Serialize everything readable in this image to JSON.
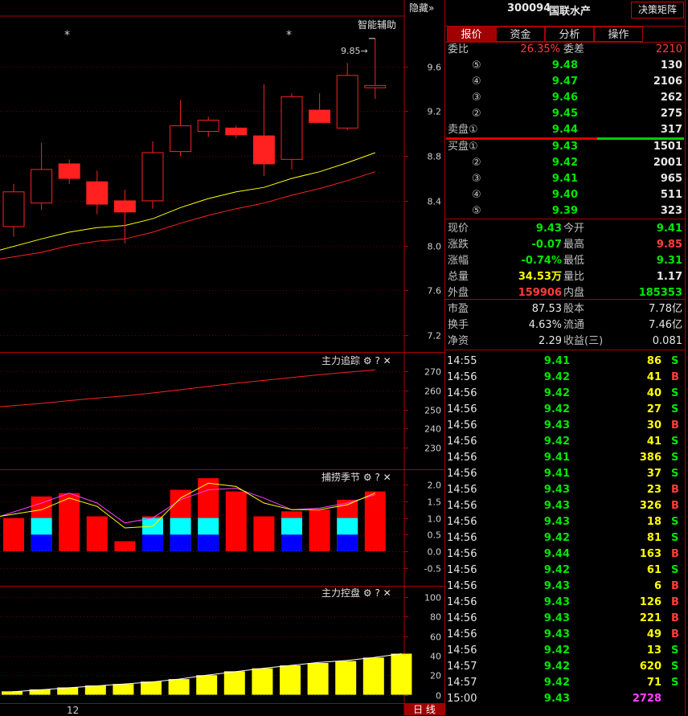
{
  "header": {
    "hide_label": "隐藏»",
    "stock_code": "300094",
    "stock_name": "国联水产",
    "matrix_button": "决策矩阵"
  },
  "tabs": [
    {
      "label": "报价",
      "active": true
    },
    {
      "label": "资金",
      "active": false
    },
    {
      "label": "分析",
      "active": false
    },
    {
      "label": "操作",
      "active": false
    }
  ],
  "order_book": {
    "weibi_label": "委比",
    "weibi_value": "26.35%",
    "weicha_label": "委差",
    "weicha_value": "2210",
    "sell": [
      {
        "label": "⑤",
        "price": "9.48",
        "vol": "130"
      },
      {
        "label": "④",
        "price": "9.47",
        "vol": "2106"
      },
      {
        "label": "③",
        "price": "9.46",
        "vol": "262"
      },
      {
        "label": "②",
        "price": "9.45",
        "vol": "275"
      },
      {
        "label": "卖盘①",
        "price": "9.44",
        "vol": "317"
      }
    ],
    "buy": [
      {
        "label": "买盘①",
        "price": "9.43",
        "vol": "1501"
      },
      {
        "label": "②",
        "price": "9.42",
        "vol": "2001"
      },
      {
        "label": "③",
        "price": "9.41",
        "vol": "965"
      },
      {
        "label": "④",
        "price": "9.40",
        "vol": "511"
      },
      {
        "label": "⑤",
        "price": "9.39",
        "vol": "323"
      }
    ]
  },
  "quote": [
    {
      "l1": "现价",
      "v1": "9.43",
      "c1": "green",
      "l2": "今开",
      "v2": "9.41",
      "c2": "green"
    },
    {
      "l1": "涨跌",
      "v1": "-0.07",
      "c1": "green",
      "l2": "最高",
      "v2": "9.85",
      "c2": "red"
    },
    {
      "l1": "涨幅",
      "v1": "-0.74%",
      "c1": "green",
      "l2": "最低",
      "v2": "9.31",
      "c2": "green"
    },
    {
      "l1": "总量",
      "v1": "34.53万",
      "c1": "yellow",
      "l2": "量比",
      "v2": "1.17",
      "c2": "white"
    },
    {
      "l1": "外盘",
      "v1": "159906",
      "c1": "red",
      "l2": "内盘",
      "v2": "185353",
      "c2": "green"
    }
  ],
  "finance": [
    {
      "l1": "市盈",
      "v1": "87.53",
      "l2": "股本",
      "v2": "7.78亿"
    },
    {
      "l1": "换手",
      "v1": "4.63%",
      "l2": "流通",
      "v2": "7.46亿"
    },
    {
      "l1": "净资",
      "v1": "2.29",
      "l2": "收益(三)",
      "v2": "0.081"
    }
  ],
  "ticks": [
    {
      "time": "14:55",
      "price": "9.41",
      "vol": "86",
      "side": "S"
    },
    {
      "time": "14:56",
      "price": "9.42",
      "vol": "41",
      "side": "B"
    },
    {
      "time": "14:56",
      "price": "9.42",
      "vol": "40",
      "side": "S"
    },
    {
      "time": "14:56",
      "price": "9.42",
      "vol": "27",
      "side": "S"
    },
    {
      "time": "14:56",
      "price": "9.43",
      "vol": "30",
      "side": "B"
    },
    {
      "time": "14:56",
      "price": "9.42",
      "vol": "41",
      "side": "S"
    },
    {
      "time": "14:56",
      "price": "9.41",
      "vol": "386",
      "side": "S"
    },
    {
      "time": "14:56",
      "price": "9.41",
      "vol": "37",
      "side": "S"
    },
    {
      "time": "14:56",
      "price": "9.43",
      "vol": "23",
      "side": "B"
    },
    {
      "time": "14:56",
      "price": "9.43",
      "vol": "326",
      "side": "B"
    },
    {
      "time": "14:56",
      "price": "9.43",
      "vol": "18",
      "side": "S"
    },
    {
      "time": "14:56",
      "price": "9.42",
      "vol": "81",
      "side": "S"
    },
    {
      "time": "14:56",
      "price": "9.44",
      "vol": "163",
      "side": "B"
    },
    {
      "time": "14:56",
      "price": "9.42",
      "vol": "61",
      "side": "S"
    },
    {
      "time": "14:56",
      "price": "9.43",
      "vol": "6",
      "side": "B"
    },
    {
      "time": "14:56",
      "price": "9.43",
      "vol": "126",
      "side": "B"
    },
    {
      "time": "14:56",
      "price": "9.43",
      "vol": "221",
      "side": "B"
    },
    {
      "time": "14:56",
      "price": "9.43",
      "vol": "49",
      "side": "B"
    },
    {
      "time": "14:56",
      "price": "9.42",
      "vol": "13",
      "side": "S"
    },
    {
      "time": "14:57",
      "price": "9.42",
      "vol": "620",
      "side": "S"
    },
    {
      "time": "14:57",
      "price": "9.42",
      "vol": "71",
      "side": "S"
    },
    {
      "time": "15:00",
      "price": "9.43",
      "vol": "2728",
      "side": ""
    }
  ],
  "chart_data": [
    {
      "type": "candlestick",
      "title": "智能辅助",
      "annotation": "9.85",
      "star_marks": [
        "*",
        "*"
      ],
      "yticks": [
        9.6,
        9.2,
        8.8,
        8.4,
        8.0,
        7.6,
        7.2
      ],
      "ylim": [
        7.05,
        10.05
      ],
      "x_label": "12",
      "period_label": "日 线",
      "candles": [
        {
          "o": 8.17,
          "h": 8.55,
          "l": 8.08,
          "c": 8.48
        },
        {
          "o": 8.38,
          "h": 8.92,
          "l": 8.32,
          "c": 8.68
        },
        {
          "o": 8.73,
          "h": 8.77,
          "l": 8.55,
          "c": 8.6
        },
        {
          "o": 8.57,
          "h": 8.67,
          "l": 8.28,
          "c": 8.37
        },
        {
          "o": 8.4,
          "h": 8.5,
          "l": 8.02,
          "c": 8.3
        },
        {
          "o": 8.4,
          "h": 8.93,
          "l": 8.33,
          "c": 8.83
        },
        {
          "o": 8.84,
          "h": 9.3,
          "l": 8.8,
          "c": 9.07
        },
        {
          "o": 9.02,
          "h": 9.15,
          "l": 8.97,
          "c": 9.12
        },
        {
          "o": 9.05,
          "h": 9.07,
          "l": 8.96,
          "c": 8.99
        },
        {
          "o": 8.98,
          "h": 9.44,
          "l": 8.62,
          "c": 8.73
        },
        {
          "o": 8.77,
          "h": 9.36,
          "l": 8.68,
          "c": 9.33
        },
        {
          "o": 9.21,
          "h": 9.36,
          "l": 9.11,
          "c": 9.1
        },
        {
          "o": 9.05,
          "h": 9.63,
          "l": 9.03,
          "c": 9.52
        },
        {
          "o": 9.41,
          "h": 9.85,
          "l": 9.31,
          "c": 9.43
        }
      ],
      "ma_yellow": [
        7.96,
        8.06,
        8.12,
        8.16,
        8.18,
        8.24,
        8.34,
        8.42,
        8.48,
        8.52,
        8.6,
        8.66,
        8.74,
        8.83
      ],
      "ma_red": [
        7.88,
        7.94,
        8.0,
        8.04,
        8.06,
        8.12,
        8.2,
        8.27,
        8.33,
        8.38,
        8.45,
        8.51,
        8.58,
        8.66
      ]
    },
    {
      "type": "line",
      "title": "主力追踪",
      "yticks": [
        270,
        260,
        250,
        240,
        230
      ],
      "ylim": [
        222,
        276
      ],
      "values": [
        251.5,
        253.2,
        254.7,
        256,
        257.2,
        258.7,
        260.4,
        262.2,
        263.8,
        265.3,
        266.8,
        268.3,
        269.6,
        270.8
      ]
    },
    {
      "type": "bar",
      "title": "捕捞季节",
      "yticks": [
        2.0,
        1.5,
        1.0,
        0.5,
        0.0,
        -0.5
      ],
      "ylim": [
        -0.85,
        2.25
      ],
      "red_bars": [
        1.0,
        1.65,
        1.75,
        1.05,
        0.3,
        1.05,
        1.85,
        2.2,
        1.8,
        1.05,
        1.2,
        1.25,
        1.55,
        1.8
      ],
      "cyan_bars": [
        0,
        1.0,
        0,
        0,
        0,
        1.0,
        1.0,
        1.0,
        0,
        0,
        1.0,
        0,
        1.0,
        0
      ],
      "blue_bars": [
        0,
        0.5,
        0,
        0,
        0,
        0.5,
        0.5,
        0.5,
        0,
        0,
        0.5,
        0,
        0.5,
        0
      ],
      "line_yellow": [
        1.05,
        1.25,
        1.6,
        1.35,
        0.7,
        0.75,
        1.6,
        2.05,
        1.95,
        1.45,
        1.25,
        1.25,
        1.4,
        1.75
      ],
      "line_magenta": [
        1.05,
        1.45,
        1.75,
        1.45,
        0.85,
        1.0,
        1.55,
        1.85,
        1.9,
        1.6,
        1.25,
        1.3,
        1.45,
        1.7
      ]
    },
    {
      "type": "bar",
      "title": "主力控盘",
      "yticks": [
        100,
        80,
        60,
        40,
        20,
        0
      ],
      "ylim": [
        -2,
        104
      ],
      "values": [
        3.5,
        5.5,
        7.5,
        9.5,
        11,
        13.5,
        16,
        20,
        24,
        27,
        30,
        32.5,
        34.5,
        38,
        42
      ],
      "line": [
        3,
        5,
        7,
        9,
        11,
        13,
        16,
        20,
        23.5,
        27,
        30,
        33,
        35,
        38,
        42
      ]
    }
  ]
}
